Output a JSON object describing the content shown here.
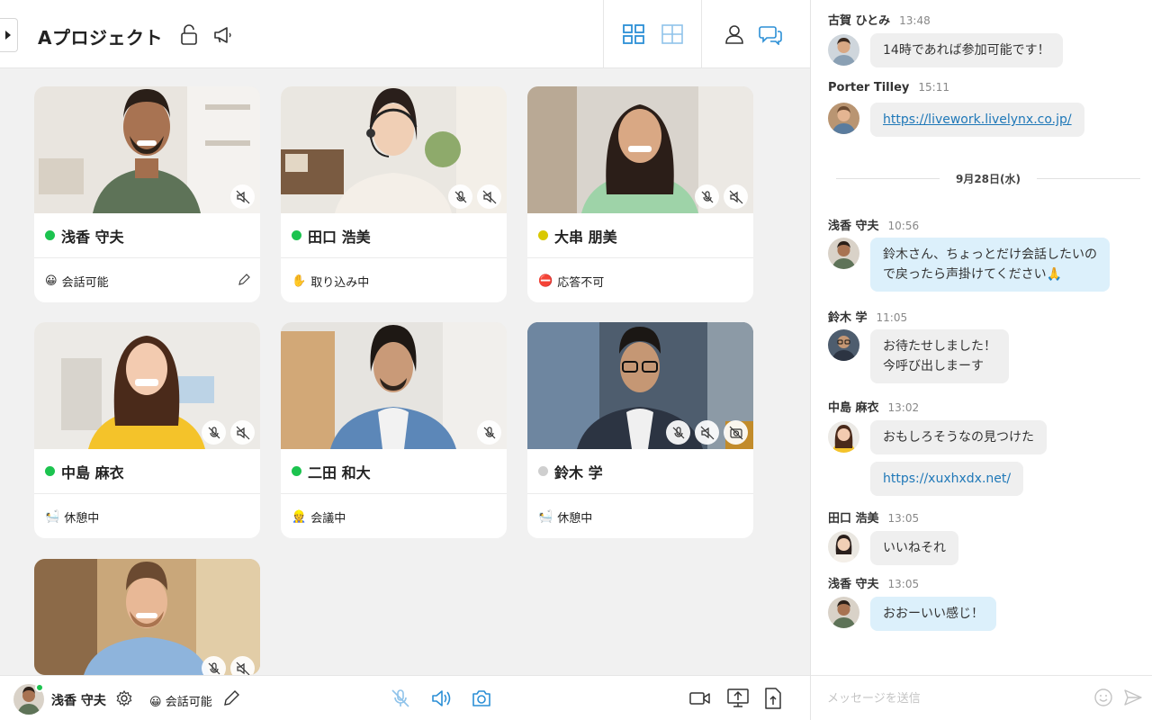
{
  "header": {
    "project_title": "Aプロジェクト",
    "lock_icon": "lock-open-icon",
    "announce_icon": "megaphone-icon",
    "view_grid_icon": "grid-view-icon",
    "view_focus_icon": "focus-view-icon",
    "members_icon": "person-icon",
    "chat_icon": "chat-bubbles-icon",
    "active_color": "#2b8fd6"
  },
  "participants": [
    {
      "name": "浅香 守夫",
      "dot": "#1cc34f",
      "status_emoji": "😀",
      "status": "会話可能",
      "mic_muted": true,
      "speaker_muted": false,
      "editable": true
    },
    {
      "name": "田口 浩美",
      "dot": "#1cc34f",
      "status_emoji": "✋",
      "status": "取り込み中",
      "mic_muted": true,
      "speaker_muted": true
    },
    {
      "name": "大串 朋美",
      "dot": "#d9c800",
      "status_emoji": "⛔",
      "status": "応答不可",
      "mic_muted": true,
      "speaker_muted": true
    },
    {
      "name": "中島 麻衣",
      "dot": "#1cc34f",
      "status_emoji": "🛀",
      "status": "休憩中",
      "mic_muted": true,
      "speaker_muted": true
    },
    {
      "name": "二田 和大",
      "dot": "#1cc34f",
      "status_emoji": "👷",
      "status": "会議中",
      "mic_muted": true
    },
    {
      "name": "鈴木 学",
      "dot": "#cfcfcf",
      "status_emoji": "🛀",
      "status": "休憩中",
      "mic_muted": true,
      "speaker_muted": true,
      "camera_off": true
    },
    {
      "name": "",
      "mic_muted": true,
      "speaker_muted": true
    }
  ],
  "bottom_bar": {
    "my_name": "浅香 守夫",
    "my_status_emoji": "😀",
    "my_status": "会話可能",
    "settings_icon": "gear-icon",
    "edit_icon": "pencil-icon",
    "mic_icon": "mic-off-icon",
    "speaker_icon": "speaker-icon",
    "camera_icon": "camera-icon",
    "video_icon": "video-camera-icon",
    "screen_share_icon": "screen-share-icon",
    "file_upload_icon": "file-upload-icon"
  },
  "chat": {
    "messages": [
      {
        "sender": "古賀 ひとみ",
        "time": "13:48",
        "text": "14時であれば参加可能です！"
      },
      {
        "sender": "Porter Tilley",
        "time": "15:11",
        "text": "https://livework.livelynx.co.jp/",
        "link": true
      },
      {
        "sender": "浅香 守夫",
        "time": "10:56",
        "text_lines": [
          "鈴木さん、ちょっとだけ会話したいの",
          "で戻ったら声掛けてください🙏"
        ],
        "mine": true
      },
      {
        "sender": "鈴木 学",
        "time": "11:05",
        "text_lines": [
          "お待たせしました！",
          "今呼び出しまーす"
        ]
      },
      {
        "sender": "中島 麻衣",
        "time": "13:02",
        "text": "おもしろそうなの見つけた",
        "text2": "https://xuxhxdx.net/"
      },
      {
        "sender": "田口 浩美",
        "time": "13:05",
        "text": "いいねそれ"
      },
      {
        "sender": "浅香 守夫",
        "time": "13:05",
        "text": "おおーいい感じ！",
        "mine": true
      }
    ],
    "date_separator": "9月28日(水)",
    "composer_placeholder": "メッセージを送信",
    "emoji_icon": "smiley-icon",
    "send_icon": "send-icon"
  }
}
